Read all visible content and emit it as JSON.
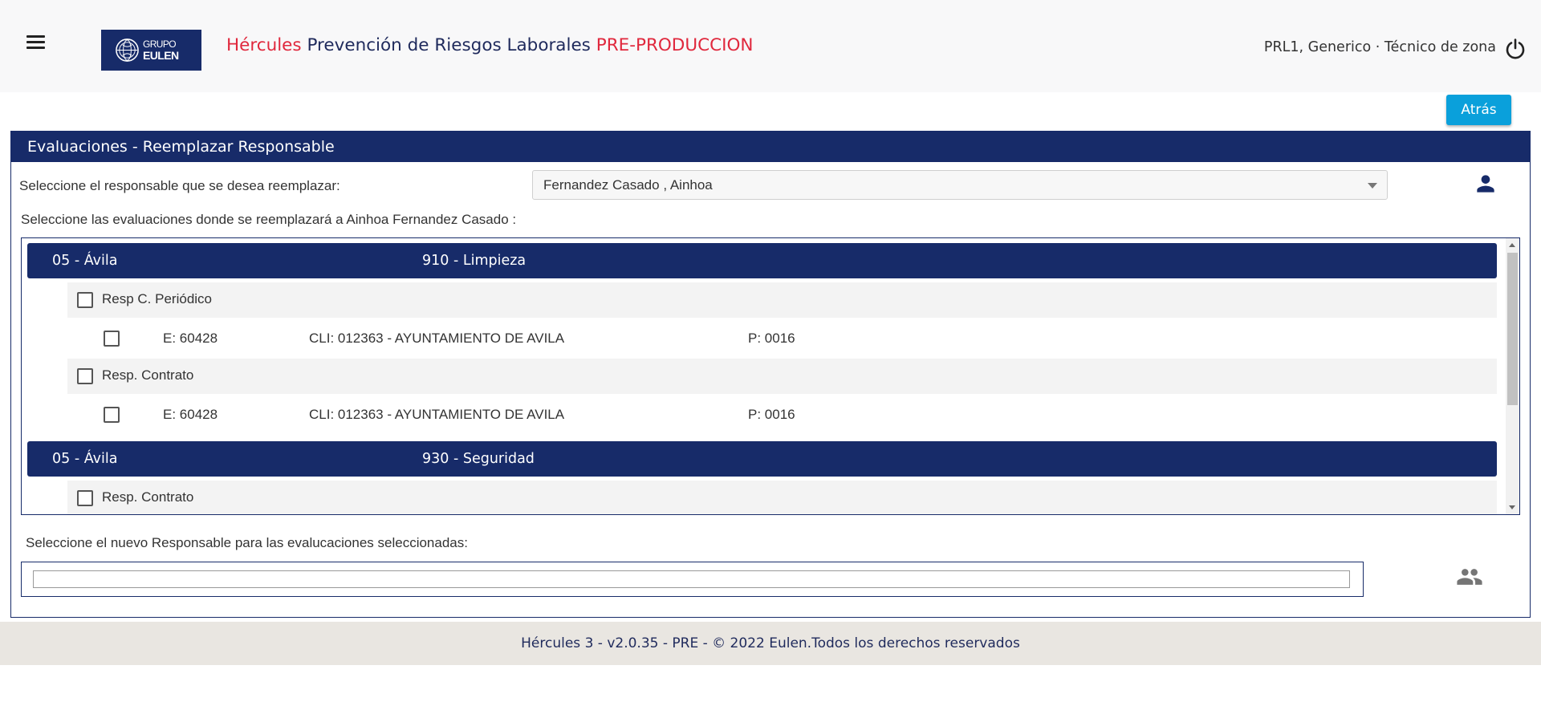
{
  "header": {
    "logo_line1": "GRUPO",
    "logo_line2": "EULEN",
    "title_part1": "Hércules",
    "title_part2": " Prevención de Riesgos Laborales ",
    "title_part3": "PRE-PRODUCCION",
    "user_info": "PRL1, Generico · Técnico de zona",
    "colors": {
      "navy": "#172b69",
      "red": "#e0283d",
      "accent": "#0aa0db"
    }
  },
  "toolbar": {
    "back_label": "Atrás"
  },
  "panel": {
    "title": "Evaluaciones - Reemplazar Responsable",
    "select_label": "Seleccione el responsable que se desea reemplazar:",
    "select_value": "Fernandez Casado , Ainhoa",
    "list_label": "Seleccione las evaluaciones donde se reemplazará a Ainhoa Fernandez Casado :",
    "groups": [
      {
        "zone": "05 - Ávila",
        "activity": "910 - Limpieza",
        "subgroups": [
          {
            "label": "Resp C. Periódico",
            "items": [
              {
                "e": "E: 60428",
                "cli": "CLI: 012363 - AYUNTAMIENTO DE AVILA",
                "p": "P: 0016"
              }
            ]
          },
          {
            "label": "Resp. Contrato",
            "items": [
              {
                "e": "E: 60428",
                "cli": "CLI: 012363 - AYUNTAMIENTO DE AVILA",
                "p": "P: 0016"
              }
            ]
          }
        ]
      },
      {
        "zone": "05 - Ávila",
        "activity": "930 - Seguridad",
        "subgroups": [
          {
            "label": "Resp. Contrato",
            "items": []
          }
        ]
      }
    ],
    "new_label": "Seleccione el nuevo Responsable para las evalucaciones seleccionadas:",
    "new_value": ""
  },
  "icons": [
    "menu-icon",
    "eulen-globe-icon",
    "power-icon",
    "person-icon",
    "group-icon",
    "chevron-down-icon"
  ],
  "footer": {
    "text": "Hércules 3 - v2.0.35 - PRE - © 2022 Eulen.Todos los derechos reservados"
  }
}
